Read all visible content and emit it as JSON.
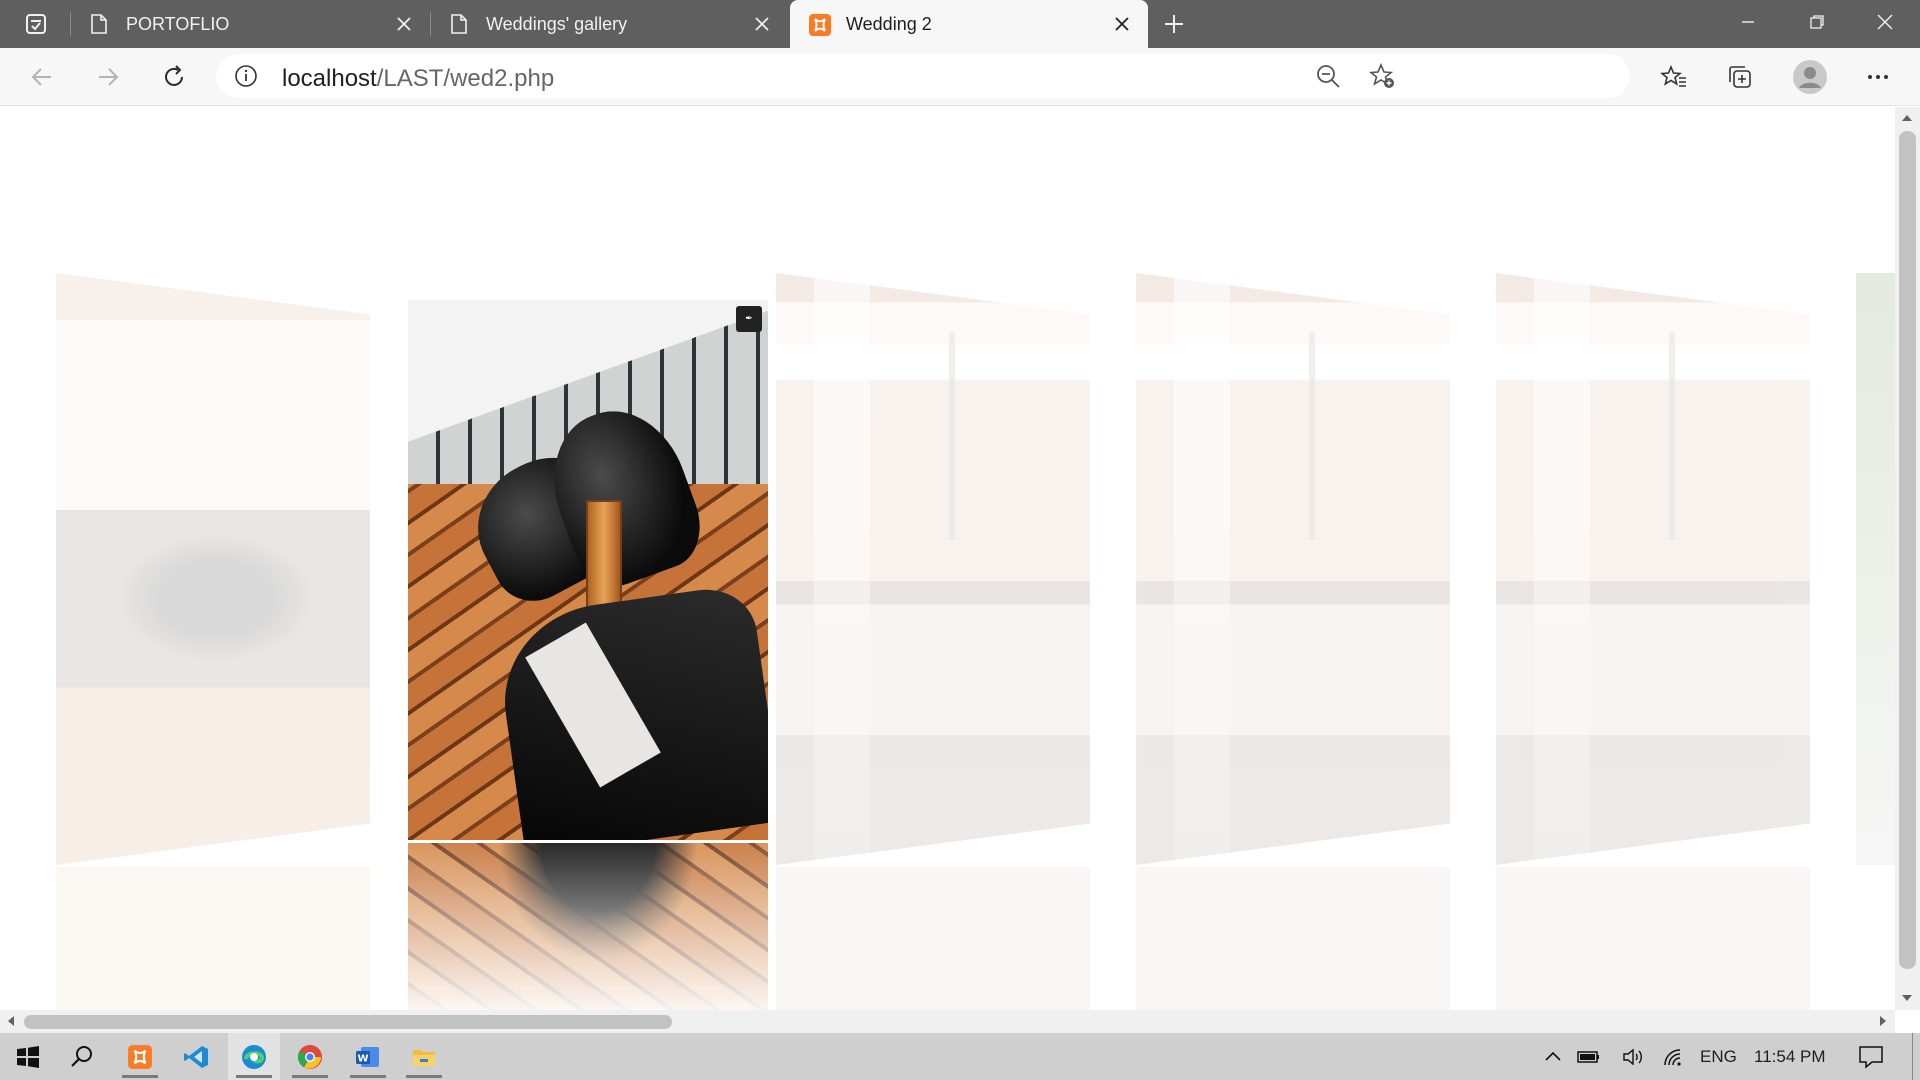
{
  "browser": {
    "tabs": [
      {
        "label": "PORTOFLIO",
        "active": false
      },
      {
        "label": "Weddings' gallery",
        "active": false
      },
      {
        "label": "Wedding 2",
        "active": true
      }
    ],
    "address": {
      "host": "localhost",
      "path": "/LAST/wed2.php"
    },
    "icons": {
      "tab_actions": "tab-actions-icon",
      "back": "back-arrow-icon",
      "forward": "forward-arrow-icon",
      "refresh": "refresh-icon",
      "info": "info-icon",
      "zoom": "zoom-out-icon",
      "add_favorite": "add-favorite-icon",
      "favorites": "favorites-icon",
      "collections": "collections-icon",
      "profile": "profile-icon",
      "menu": "more-menu-icon"
    }
  },
  "gallery": {
    "focused_image": "shoes-and-suit-photo",
    "cards": [
      "bowtie-photo",
      "shoes-and-suit-photo",
      "hotel-couple-photo-1",
      "hotel-couple-photo-2",
      "hotel-couple-photo-3"
    ]
  },
  "taskbar": {
    "apps": [
      "start",
      "search",
      "xampp",
      "vscode",
      "edge",
      "chrome",
      "word",
      "file-explorer"
    ],
    "tray": {
      "language": "ENG",
      "time": "11:54 PM"
    }
  }
}
